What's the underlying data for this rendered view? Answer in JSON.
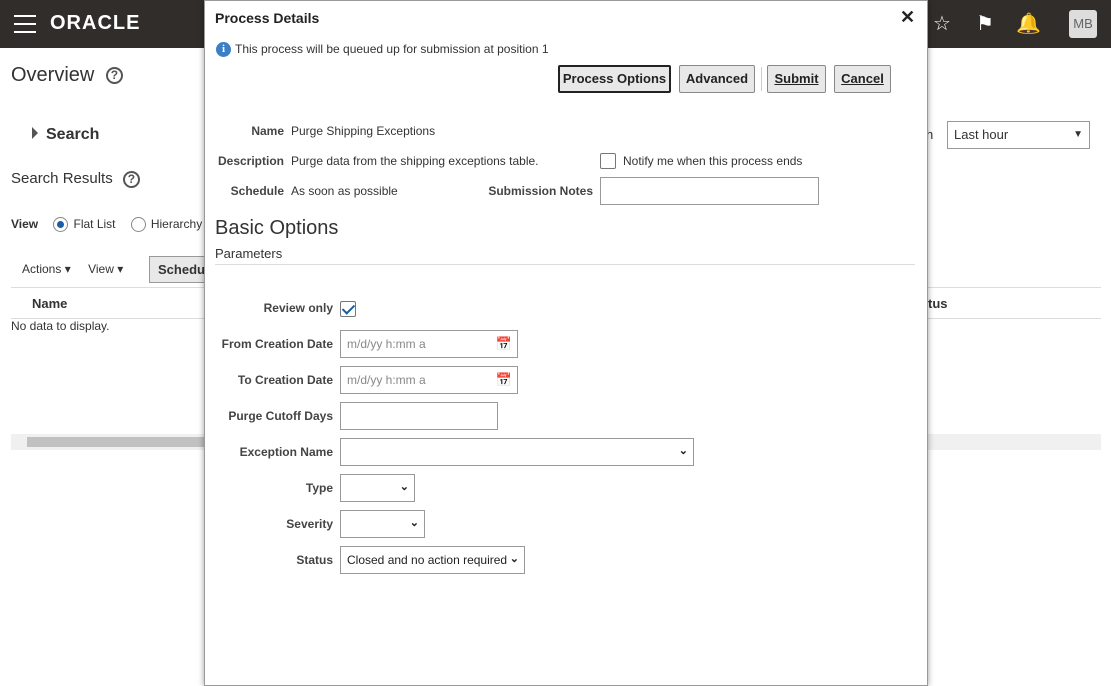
{
  "app": {
    "logo": "ORACLE",
    "avatar_initials": "MB",
    "page_title": "Overview",
    "help_glyph": "?",
    "search_label": "Search",
    "search_results_label": "Search Results",
    "view_label": "View",
    "view_options": [
      "Flat List",
      "Hierarchy"
    ],
    "actions_label": "Actions",
    "view_menu_label": "View",
    "schedule_button": "Schedul",
    "table_columns": [
      "Name",
      "tus"
    ],
    "no_data": "No data to display.",
    "period_label_partial": "h",
    "period_value": "Last hour",
    "icons": [
      "hamburger-icon",
      "star-icon",
      "flag-icon",
      "bell-icon"
    ]
  },
  "dialog": {
    "title": "Process Details",
    "close_glyph": "✕",
    "info_text": "This process will be queued up for submission at position 1",
    "buttons": {
      "process_options": "Process Options",
      "advanced": "Advanced",
      "submit": "Submit",
      "cancel": "Cancel"
    },
    "fields": {
      "name_label": "Name",
      "name_value": "Purge Shipping Exceptions",
      "description_label": "Description",
      "description_value": "Purge data from the shipping exceptions table.",
      "notify_label": "Notify me when this process ends",
      "schedule_label": "Schedule",
      "schedule_value": "As soon as possible",
      "submission_notes_label": "Submission Notes",
      "submission_notes_value": ""
    },
    "section_title": "Basic Options",
    "section_subtitle": "Parameters",
    "parameters": {
      "review_only_label": "Review only",
      "review_only_checked": true,
      "from_date_label": "From Creation Date",
      "from_date_placeholder": "m/d/yy h:mm a",
      "to_date_label": "To Creation Date",
      "to_date_placeholder": "m/d/yy h:mm a",
      "purge_cutoff_label": "Purge Cutoff Days",
      "purge_cutoff_value": "",
      "exception_name_label": "Exception Name",
      "exception_name_value": "",
      "type_label": "Type",
      "type_value": "",
      "severity_label": "Severity",
      "severity_value": "",
      "status_label": "Status",
      "status_value": "Closed and no action required"
    }
  }
}
